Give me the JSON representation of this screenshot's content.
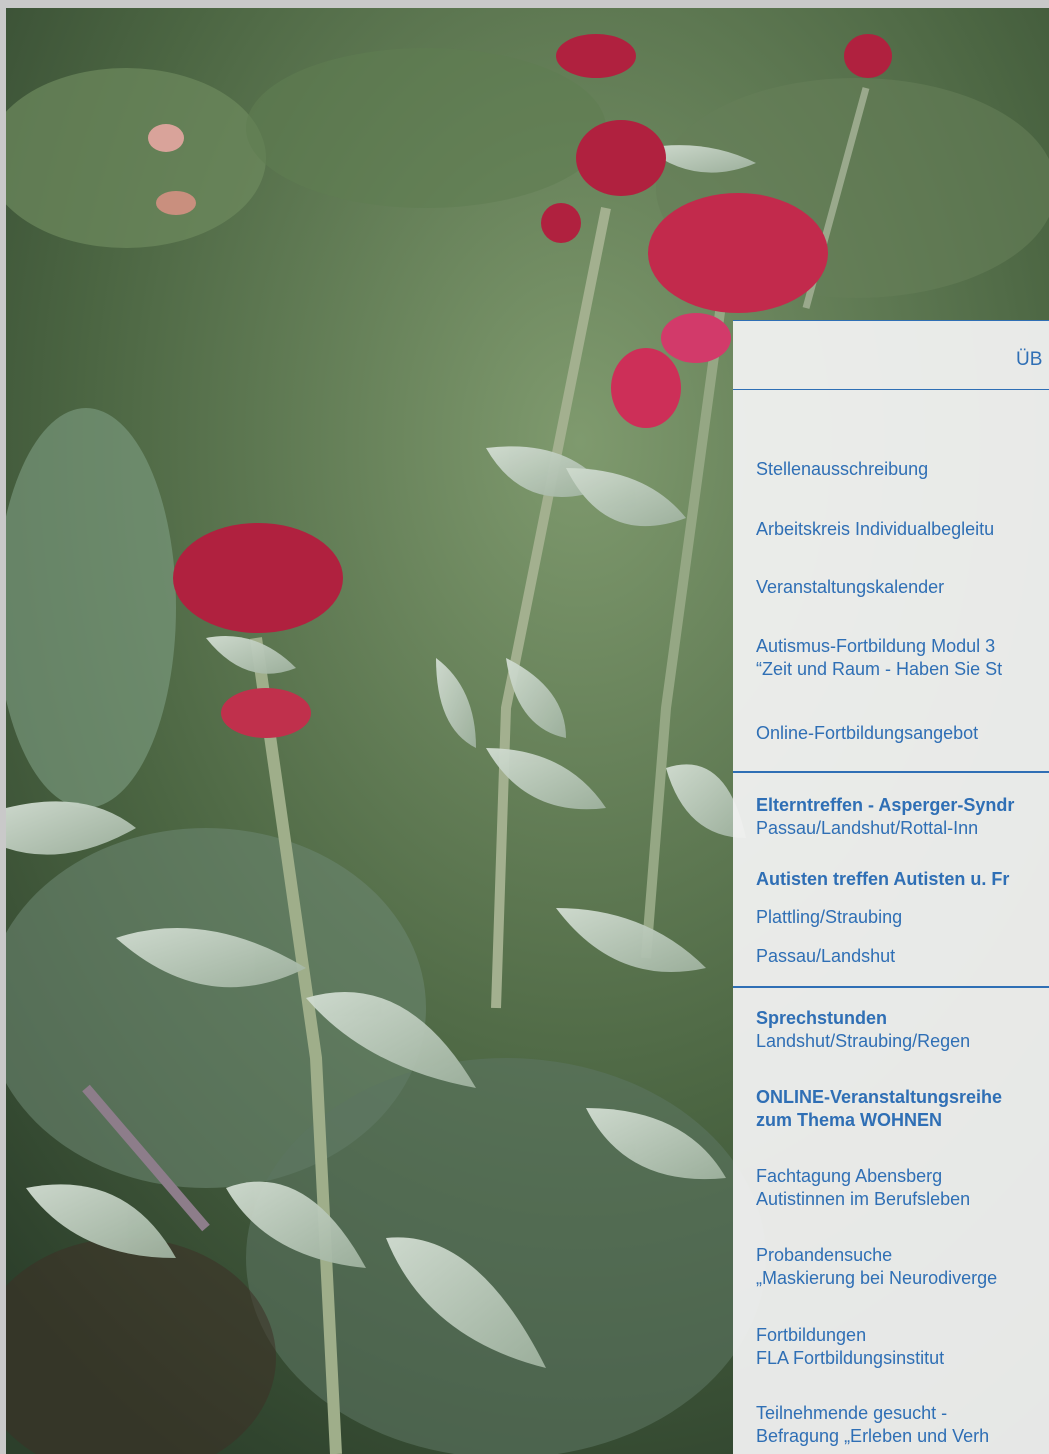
{
  "panel": {
    "title": "ÜB",
    "section1": {
      "stellen": "Stellenausschreibung",
      "arbeitskreis": "Arbeitskreis Individualbegleitu",
      "kalender": "Veranstaltungskalender",
      "fortbildung_line1": "Autismus-Fortbildung Modul 3",
      "fortbildung_line2": "“Zeit und Raum - Haben Sie St",
      "online": "Online-Fortbildungsangebot"
    },
    "section2": {
      "eltern_title": "Elterntreffen - Asperger-Syndr",
      "eltern_places": "Passau/Landshut/Rottal-Inn",
      "autisten_title": "Autisten treffen Autisten u. Fr",
      "autisten_place1": "Plattling/Straubing",
      "autisten_place2": "Passau/Landshut"
    },
    "section3": {
      "sprech_title": "Sprechstunden",
      "sprech_places": "Landshut/Straubing/Regen",
      "wohnen_line1": "ONLINE-Veranstaltungsreihe",
      "wohnen_line2": "zum Thema WOHNEN",
      "fachtagung_line1": "Fachtagung Abensberg",
      "fachtagung_line2": "Autistinnen im Berufsleben",
      "proband_line1": "Probandensuche",
      "proband_line2": "„Maskierung bei Neurodiverge",
      "fla_line1": "Fortbildungen",
      "fla_line2": "FLA Fortbildungsinstitut",
      "teilnehmende_line1": "Teilnehmende gesucht -",
      "teilnehmende_line2": "Befragung „Erleben und Verh"
    }
  },
  "colors": {
    "link_blue": "#2f6fb5",
    "panel_bg": "#f2f2f2",
    "flower_red": "#b0213f"
  }
}
